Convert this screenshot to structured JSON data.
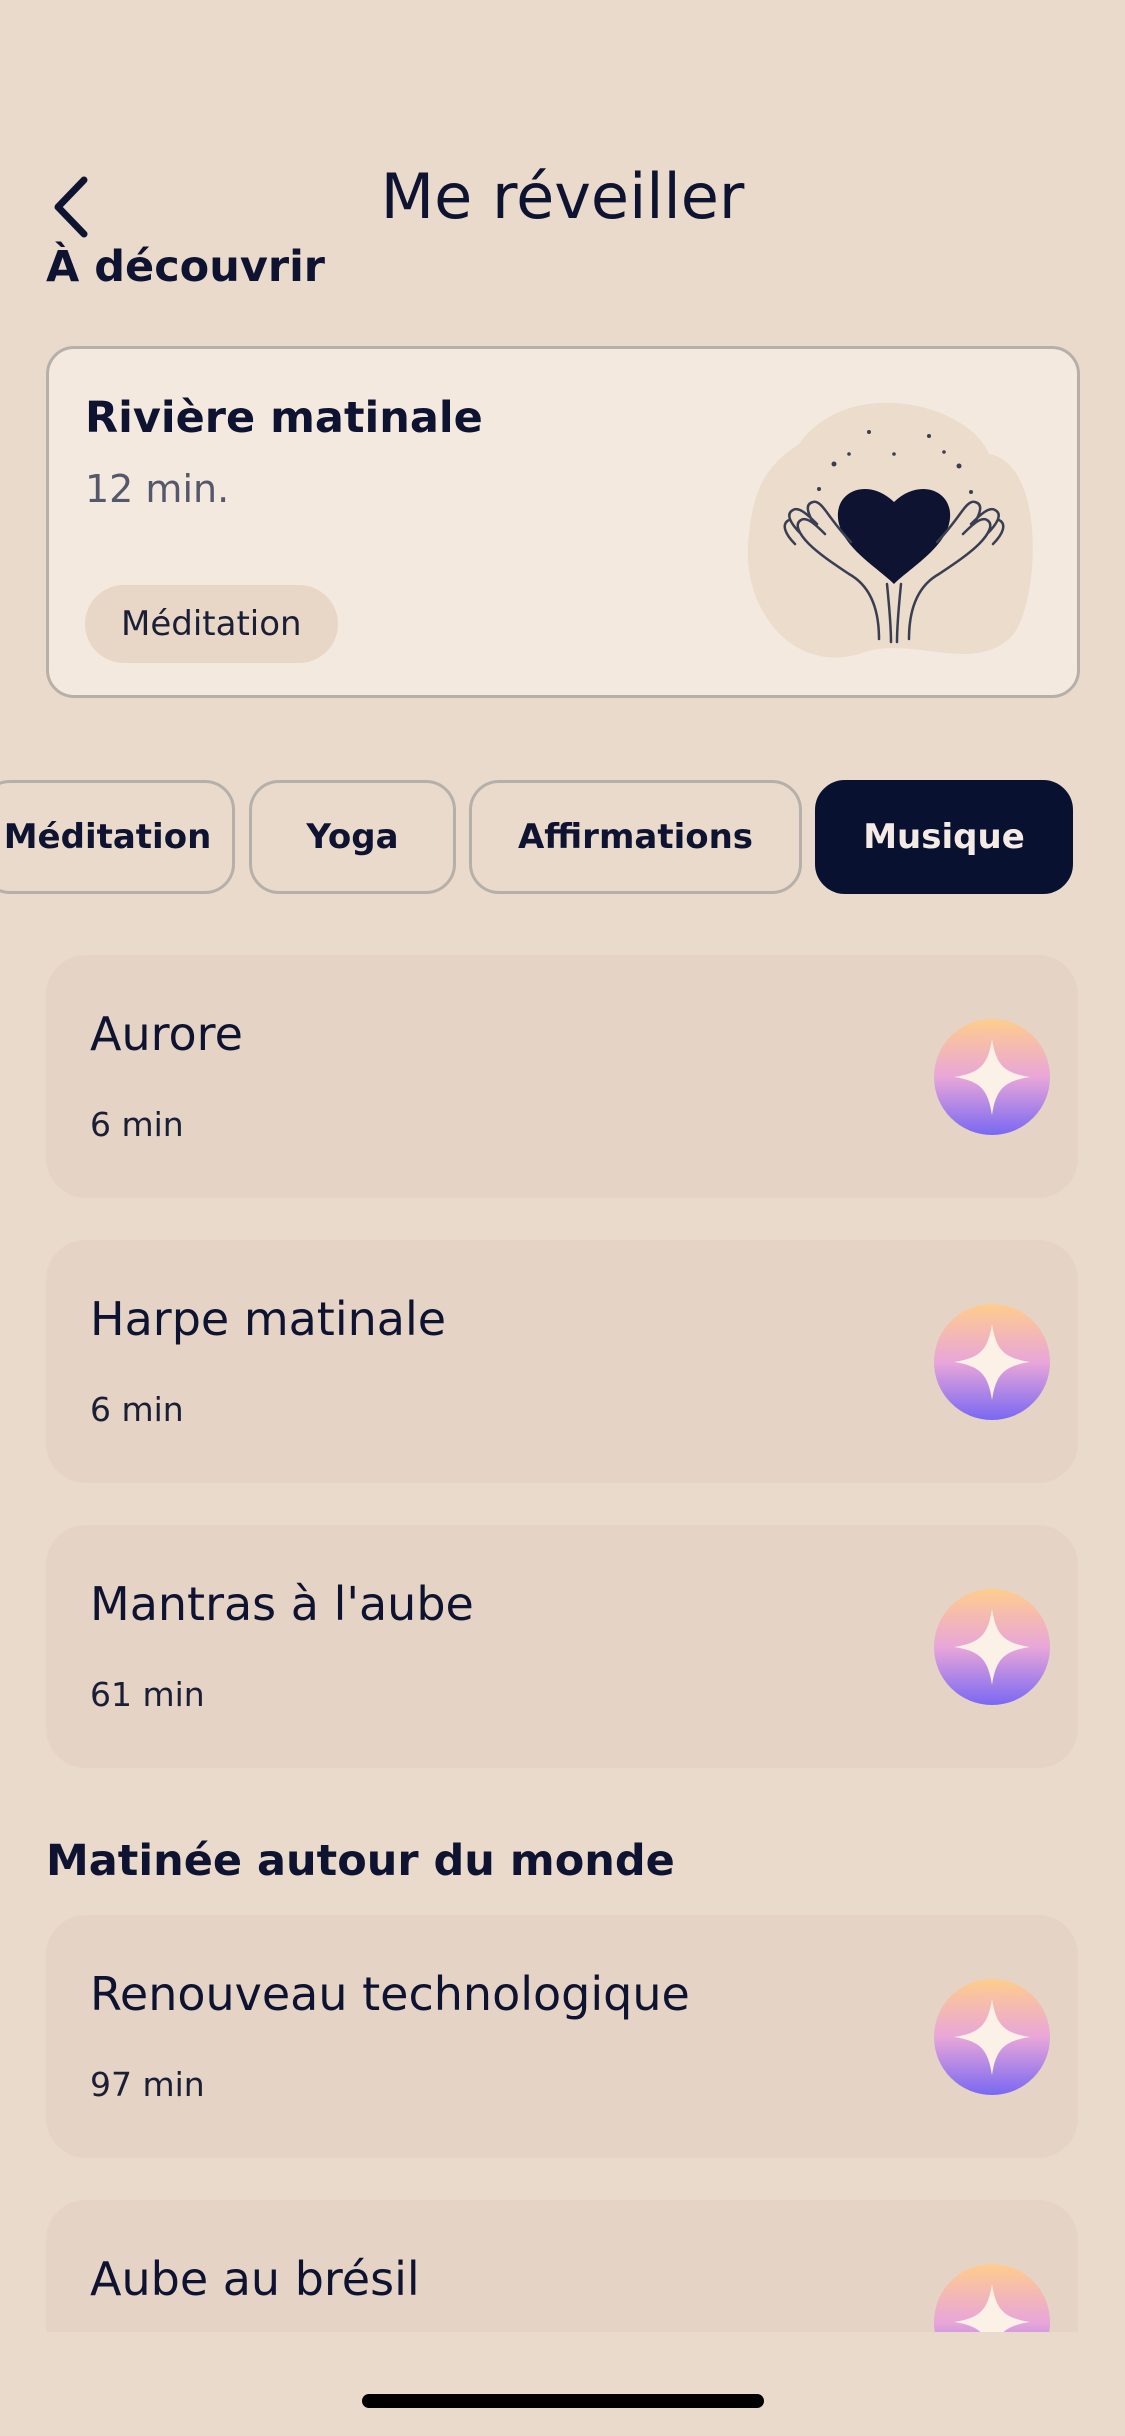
{
  "header": {
    "title": "Me réveiller"
  },
  "discover": {
    "section_title": "À découvrir",
    "featured": {
      "title": "Rivière matinale",
      "duration": "12 min.",
      "tag": "Méditation"
    }
  },
  "filters": [
    {
      "label": "Méditation",
      "active": false
    },
    {
      "label": "Yoga",
      "active": false
    },
    {
      "label": "Affirmations",
      "active": false
    },
    {
      "label": "Musique",
      "active": true
    }
  ],
  "tracks": [
    {
      "title": "Aurore",
      "duration": "6 min"
    },
    {
      "title": "Harpe matinale",
      "duration": "6 min"
    },
    {
      "title": "Mantras à l'aube",
      "duration": "61 min"
    }
  ],
  "world": {
    "section_title": "Matinée autour du monde",
    "tracks": [
      {
        "title": "Renouveau technologique",
        "duration": "97 min"
      },
      {
        "title": "Aube au brésil",
        "duration": ""
      }
    ]
  },
  "colors": {
    "background": "#e9dacb",
    "accent_dark": "#091131",
    "card": "#e5d3c5",
    "icon_gradient_top": "#ffc98a",
    "icon_gradient_bottom": "#7b6cf5"
  },
  "icons": {
    "back": "chevron-left-icon",
    "featured_art": "hands-heart-icon",
    "track": "sparkle-icon"
  }
}
